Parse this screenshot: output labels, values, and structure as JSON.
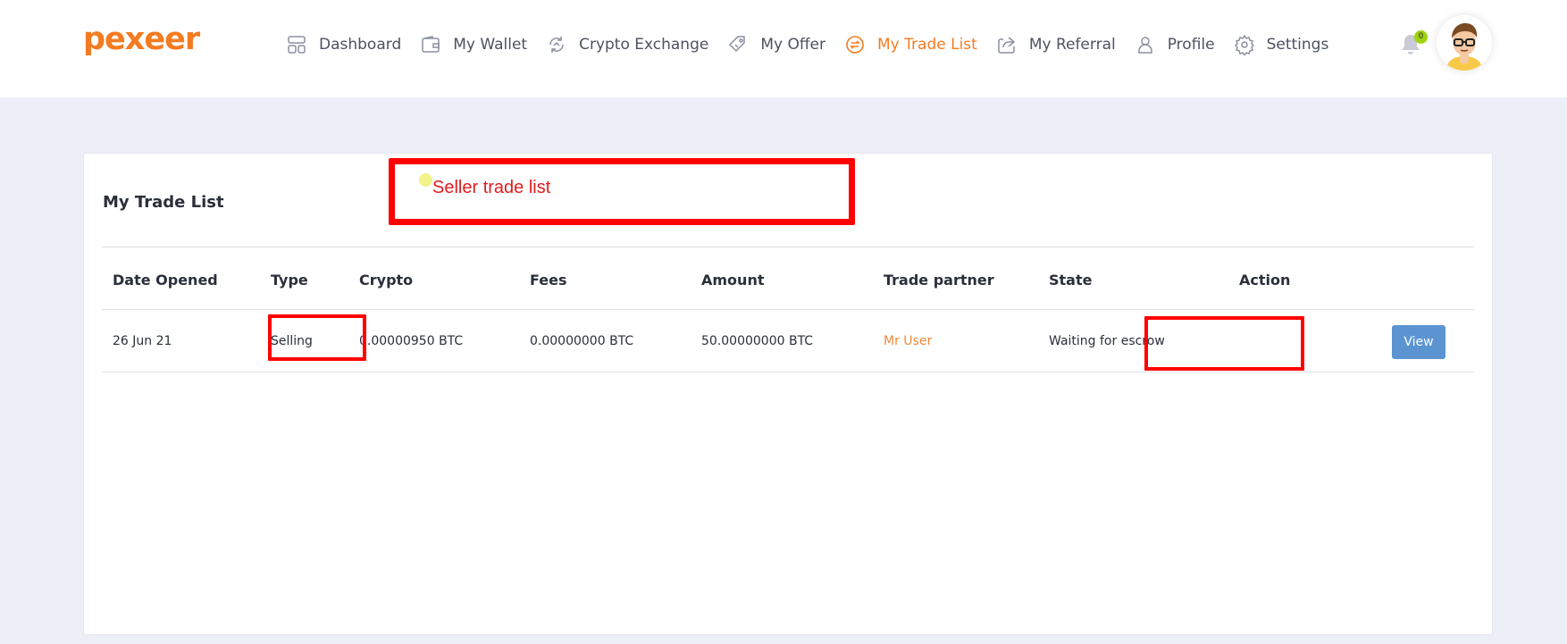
{
  "brand": {
    "logo": "pexeer",
    "accent": "#f47b20"
  },
  "nav": {
    "items": [
      {
        "label": "Dashboard",
        "icon": "dashboard-icon"
      },
      {
        "label": "My Wallet",
        "icon": "wallet-icon"
      },
      {
        "label": "Crypto Exchange",
        "icon": "exchange-icon"
      },
      {
        "label": "My Offer",
        "icon": "tag-icon"
      },
      {
        "label": "My Trade List",
        "icon": "trade-icon",
        "active": true
      },
      {
        "label": "My Referral",
        "icon": "share-icon"
      },
      {
        "label": "Profile",
        "icon": "user-icon"
      },
      {
        "label": "Settings",
        "icon": "gear-icon"
      }
    ],
    "notifications": "0"
  },
  "card": {
    "title": "My Trade List"
  },
  "annotation": {
    "text": "Seller trade list",
    "color": "#ff0000"
  },
  "table": {
    "headers": [
      "Date Opened",
      "Type",
      "Crypto",
      "Fees",
      "Amount",
      "Trade partner",
      "State",
      "Action"
    ],
    "rows": [
      {
        "date": "26 Jun 21",
        "type": "Selling",
        "crypto": "0.00000950 BTC",
        "fees": "0.00000000 BTC",
        "amount": "50.00000000 BTC",
        "partner": "Mr User",
        "state": "Waiting for escrow",
        "action": "View"
      }
    ]
  },
  "colors": {
    "page_bg": "#eceff6",
    "button": "#5b94d1",
    "partner_link": "#f0883a",
    "badge": "#9fd20f"
  }
}
